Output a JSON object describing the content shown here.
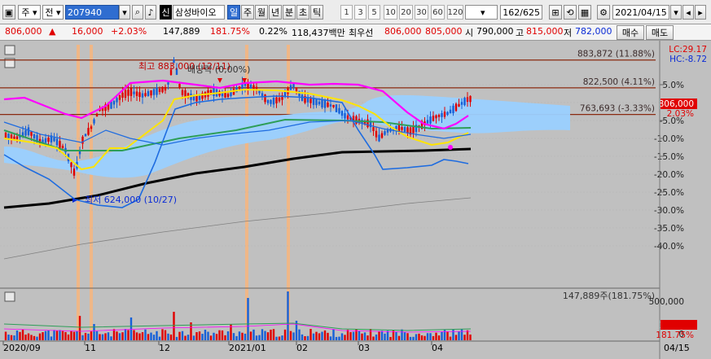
{
  "toolbar": {
    "market": "주",
    "type": "전",
    "code": "207940",
    "name": "삼성바이오",
    "badge": "신",
    "periods": [
      "일",
      "주",
      "월",
      "년",
      "분",
      "초",
      "틱"
    ],
    "active_period": "일",
    "intervals": [
      "1",
      "3",
      "5",
      "10",
      "20",
      "30",
      "60",
      "120"
    ],
    "count": "162",
    "total": "/625",
    "date": "2021/04/15"
  },
  "info": {
    "price": "806,000",
    "change": "16,000",
    "change_pct": "+2.03%",
    "volume": "147,889",
    "vol_ratio": "181.75%",
    "turnover": "0.22%",
    "amount": "118,437백만",
    "best_label": "최우선",
    "ask": "806,000",
    "bid": "805,000",
    "open_label": "시",
    "open": "790,000",
    "high_label": "고",
    "high": "815,000",
    "low_label": "저",
    "low": "782,000",
    "buy_label": "매수",
    "sell_label": "매도"
  },
  "colors": {
    "bg": "#c0c0c0",
    "up": "#e00000",
    "down": "#1560d8",
    "ma_black": "#000000",
    "ma_green": "#2e9e58",
    "ma_gray": "#808080",
    "envelope": "#ff00ff",
    "yellow": "#ffe400",
    "band": "#0064ff",
    "cloud": "#9ad0ff",
    "hline": "#8a2a10",
    "highlight": "#f7b57c"
  },
  "chart_data": {
    "type": "candlestick",
    "x_labels": [
      "2020/09",
      "11",
      "12",
      "2021/01",
      "02",
      "03",
      "04"
    ],
    "right_date": "04/15",
    "y_percent_ticks": [
      "5.0%",
      "0.0%",
      "-5.0%",
      "-10.0%",
      "-15.0%",
      "-20.0%",
      "-25.0%",
      "-30.0%",
      "-35.0%",
      "-40.0%"
    ],
    "lc": "LC:29.17",
    "hc": "HC:-8.72",
    "current_price": "806,000",
    "current_pct": "2.03%",
    "hlines": [
      {
        "label": "883,872 (11.88%)",
        "value": 883872
      },
      {
        "label": "822,500 (4.11%)",
        "value": 822500
      },
      {
        "label": "763,693 (-3.33%)",
        "value": 763693
      }
    ],
    "annotations": {
      "high": "최고 883,000 (12/11)",
      "low": "최저 624,000 (10/27)",
      "dividend": "배당락 (0,00%)"
    },
    "volume_header": "147,889주(181.75%)",
    "volume_tick": "500,000",
    "volume_tick_zero": "0",
    "volume_current": "147,889",
    "volume_pct": "181.75%"
  }
}
